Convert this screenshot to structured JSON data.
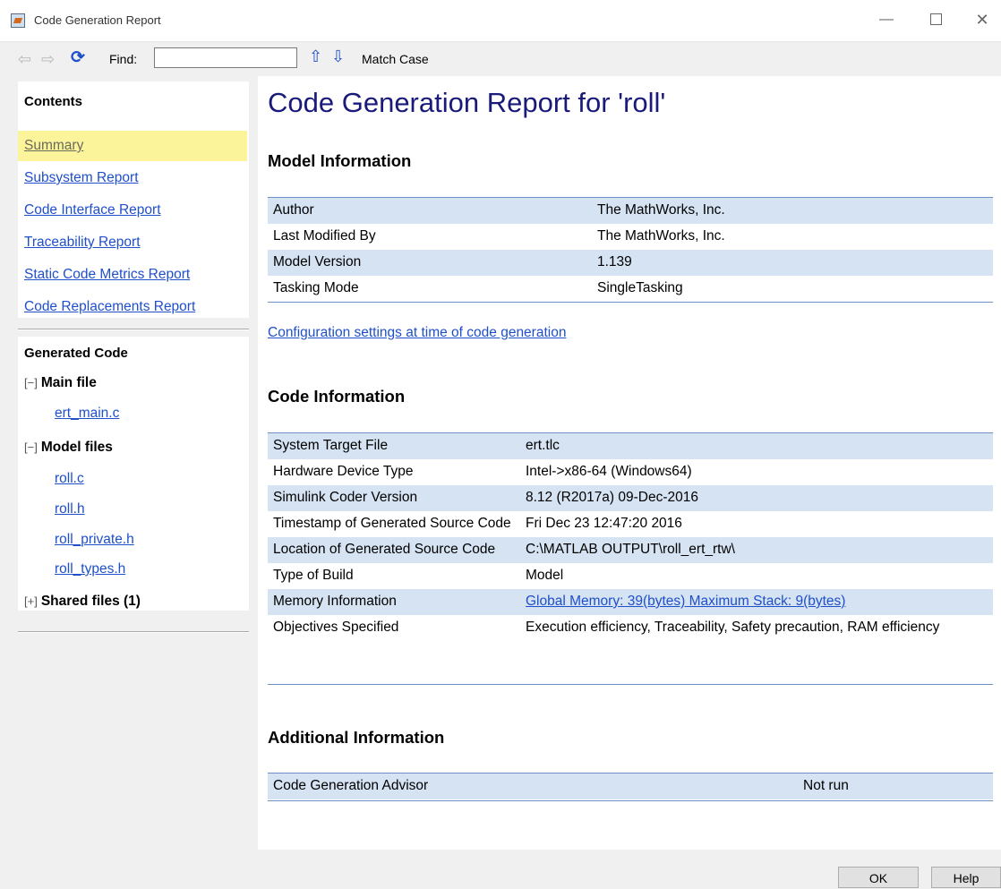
{
  "window": {
    "title": "Code Generation Report",
    "minimize_glyph": "—",
    "close_glyph": "✕"
  },
  "toolbar": {
    "back_icon": "back-arrow-icon",
    "forward_icon": "forward-arrow-icon",
    "refresh_icon": "refresh-icon",
    "find_label": "Find:",
    "find_value": "",
    "find_prev_icon": "up-arrow-icon",
    "find_next_icon": "down-arrow-icon",
    "match_case_label": "Match Case"
  },
  "contents": {
    "heading": "Contents",
    "items": [
      {
        "label": "Summary",
        "active": true
      },
      {
        "label": "Subsystem Report"
      },
      {
        "label": "Code Interface Report"
      },
      {
        "label": "Traceability Report"
      },
      {
        "label": "Static Code Metrics Report"
      },
      {
        "label": "Code Replacements Report"
      }
    ]
  },
  "generated_code": {
    "heading": "Generated Code",
    "groups": [
      {
        "toggle": "[−]",
        "label": "Main file",
        "files": [
          "ert_main.c"
        ]
      },
      {
        "toggle": "[−]",
        "label": "Model files",
        "files": [
          "roll.c",
          "roll.h",
          "roll_private.h",
          "roll_types.h"
        ]
      },
      {
        "toggle": "[+]",
        "label": "Shared files (1)",
        "files": []
      }
    ]
  },
  "report": {
    "title": "Code Generation Report for 'roll'",
    "model_info": {
      "heading": "Model Information",
      "rows": [
        {
          "key": "Author",
          "value": "The MathWorks, Inc."
        },
        {
          "key": "Last Modified By",
          "value": "The MathWorks, Inc."
        },
        {
          "key": "Model Version",
          "value": "1.139"
        },
        {
          "key": "Tasking Mode",
          "value": "SingleTasking"
        }
      ]
    },
    "config_link": "Configuration settings at time of code generation",
    "code_info": {
      "heading": "Code Information",
      "rows": [
        {
          "key": "System Target File",
          "value": "ert.tlc"
        },
        {
          "key": "Hardware Device Type",
          "value": "Intel->x86-64 (Windows64)"
        },
        {
          "key": "Simulink Coder Version",
          "value": "8.12 (R2017a) 09-Dec-2016"
        },
        {
          "key": "Timestamp of Generated Source Code",
          "value": "Fri Dec 23 12:47:20 2016"
        },
        {
          "key": "Location of Generated Source Code",
          "value": "C:\\MATLAB OUTPUT\\roll_ert_rtw\\"
        },
        {
          "key": "Type of Build",
          "value": "Model"
        },
        {
          "key": "Memory Information",
          "value": "Global Memory: 39(bytes) Maximum Stack: 9(bytes)",
          "link": true
        },
        {
          "key": "Objectives Specified",
          "value": "Execution efficiency, Traceability, Safety precaution, RAM efficiency"
        }
      ]
    },
    "additional_info": {
      "heading": "Additional Information",
      "rows": [
        {
          "key": "Code Generation Advisor",
          "value": "Not run"
        }
      ]
    }
  },
  "buttons": {
    "ok": "OK",
    "help": "Help"
  }
}
